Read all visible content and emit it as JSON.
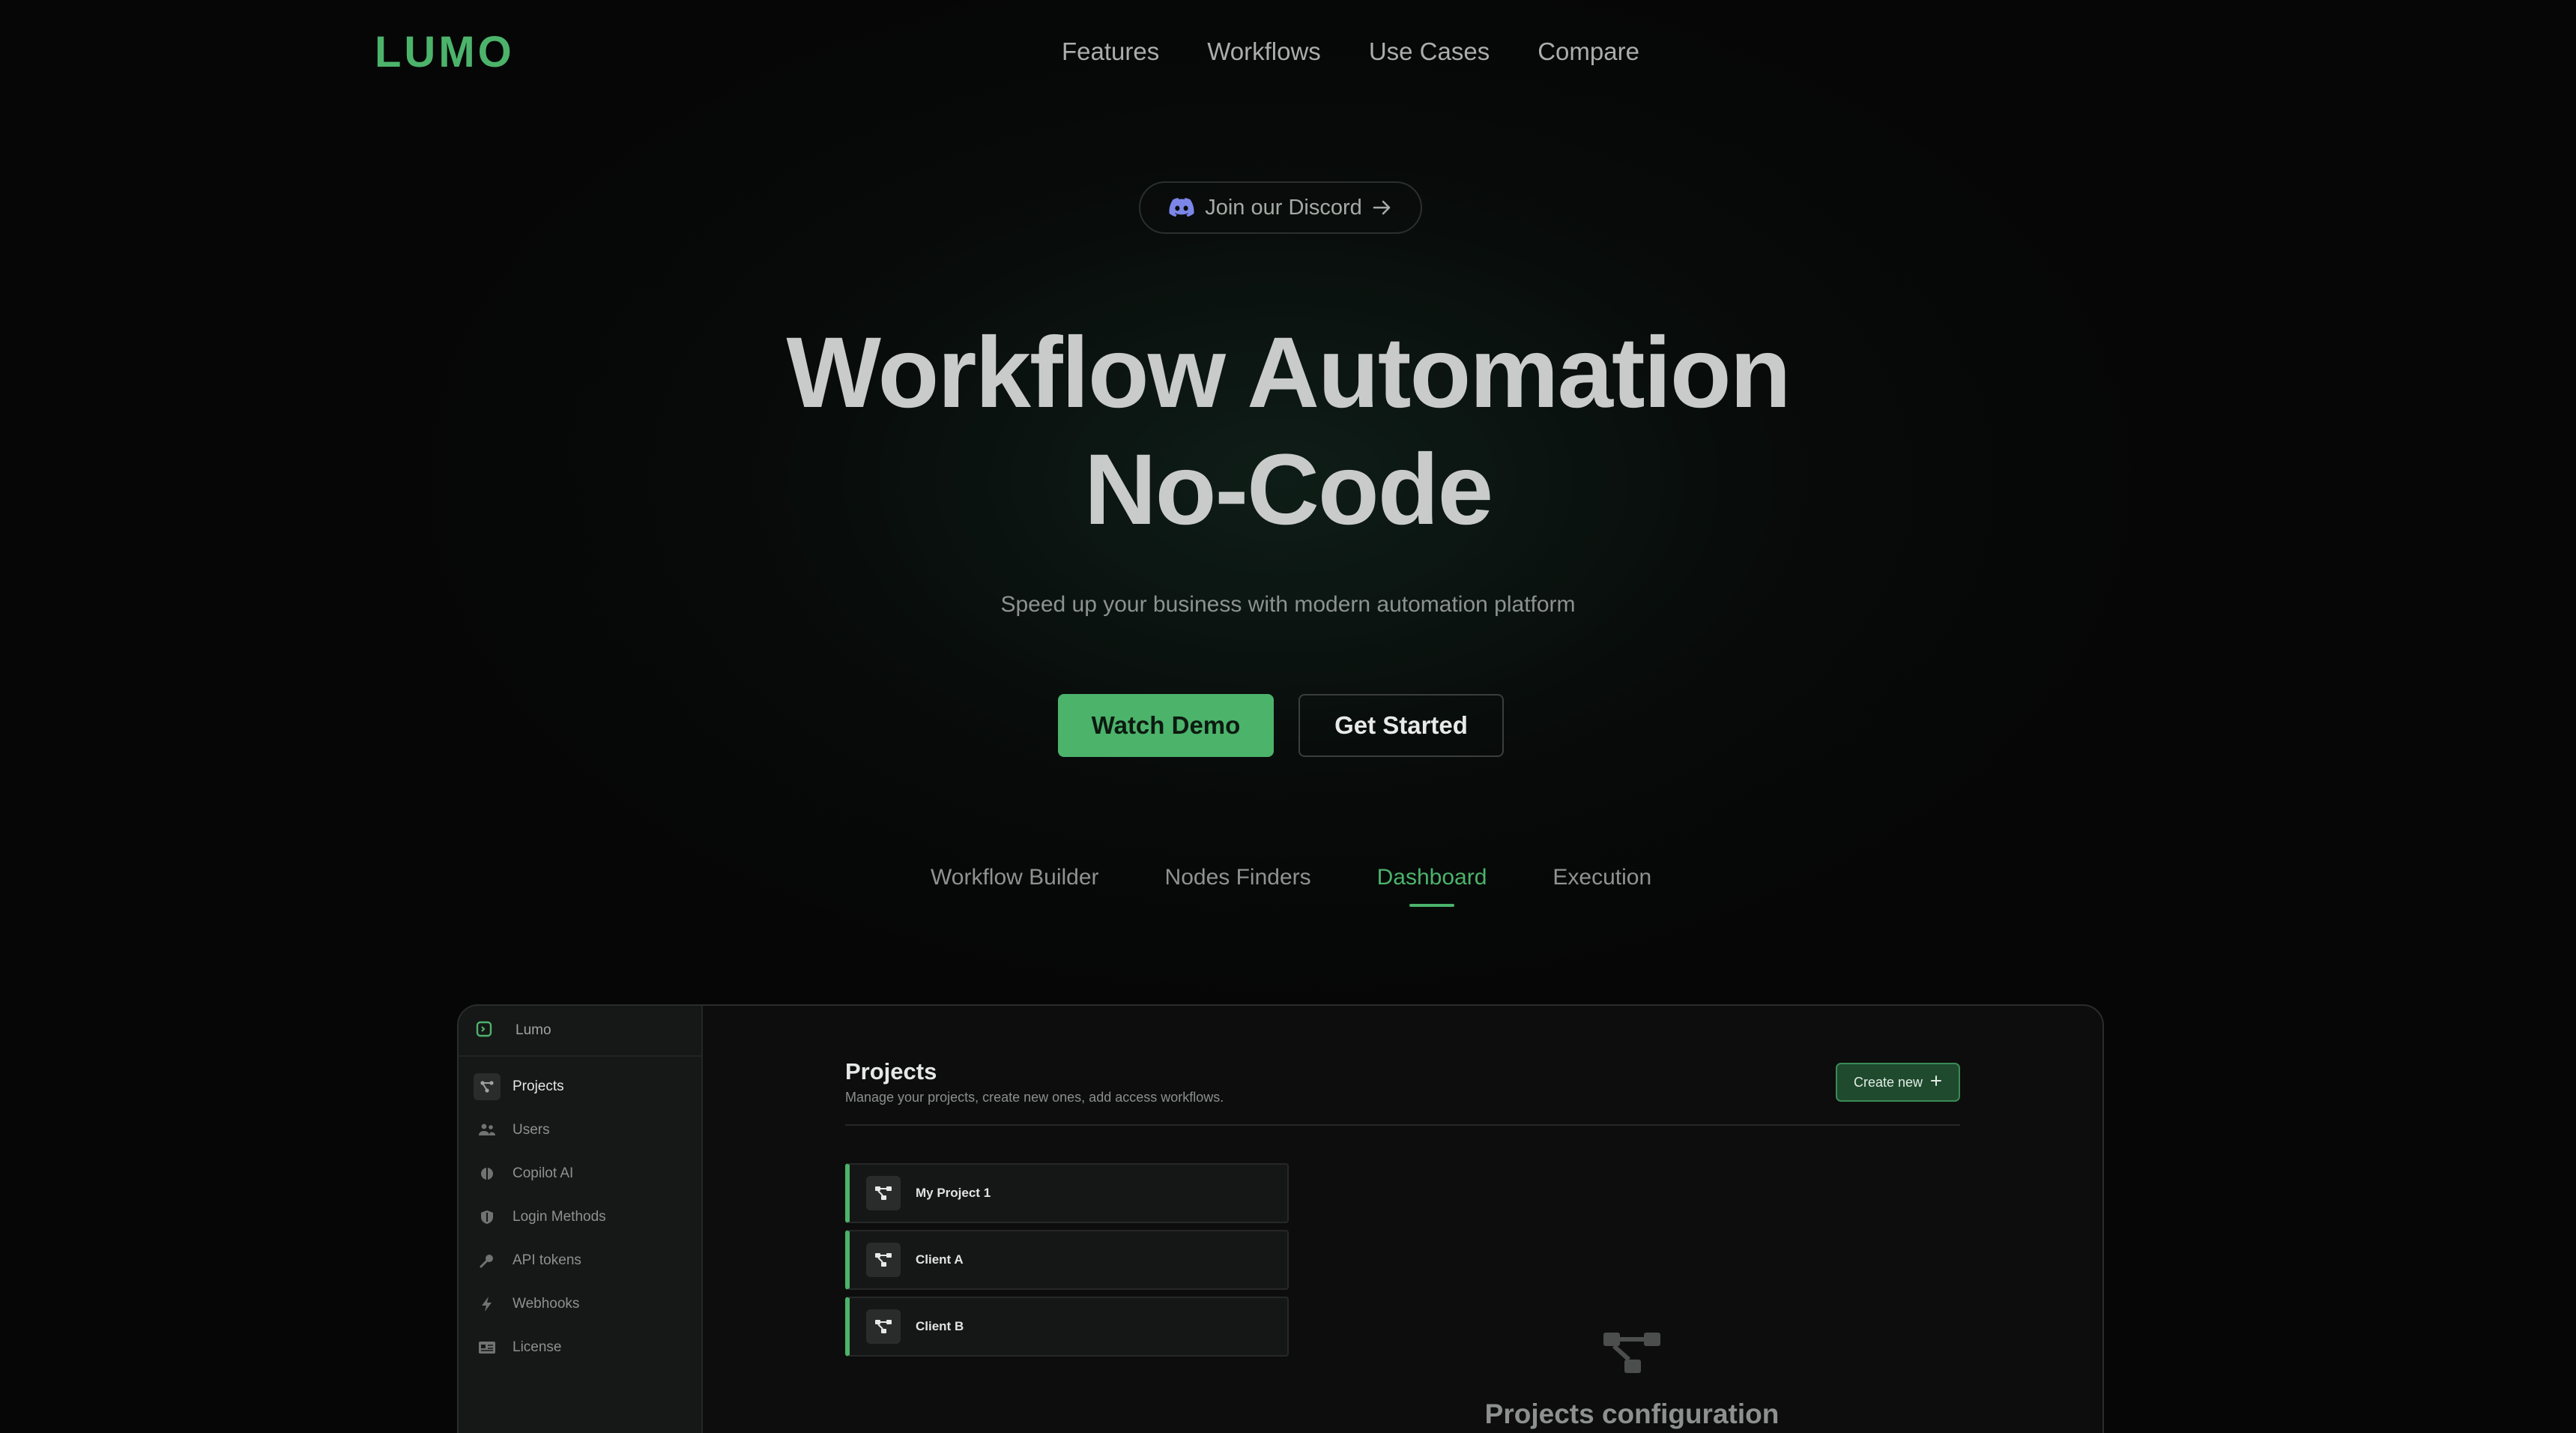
{
  "brand": {
    "logo": "LUMO",
    "accent": "#4cb36b"
  },
  "nav": {
    "items": [
      {
        "label": "Features"
      },
      {
        "label": "Workflows"
      },
      {
        "label": "Use Cases"
      },
      {
        "label": "Compare"
      }
    ]
  },
  "hero": {
    "discord_label": "Join our Discord",
    "title_line1": "Workflow Automation",
    "title_line2": "No-Code",
    "subtitle": "Speed up your business with modern automation platform",
    "watch_demo": "Watch Demo",
    "get_started": "Get Started"
  },
  "tabs": {
    "items": [
      {
        "label": "Workflow Builder"
      },
      {
        "label": "Nodes Finders"
      },
      {
        "label": "Dashboard",
        "active": true
      },
      {
        "label": "Execution"
      }
    ]
  },
  "app": {
    "sidebar": {
      "brand": "Lumo",
      "items": [
        {
          "label": "Projects",
          "icon": "workflow-icon",
          "active": true
        },
        {
          "label": "Users",
          "icon": "users-icon"
        },
        {
          "label": "Copilot AI",
          "icon": "brain-icon"
        },
        {
          "label": "Login Methods",
          "icon": "shield-icon"
        },
        {
          "label": "API tokens",
          "icon": "key-icon"
        },
        {
          "label": "Webhooks",
          "icon": "bolt-icon"
        },
        {
          "label": "License",
          "icon": "id-card-icon"
        }
      ]
    },
    "main": {
      "title": "Projects",
      "subtitle": "Manage your projects, create new ones, add access workflows.",
      "create_label": "Create new",
      "projects": [
        {
          "label": "My Project 1"
        },
        {
          "label": "Client A"
        },
        {
          "label": "Client B"
        }
      ],
      "empty_title": "Projects configuration"
    }
  }
}
